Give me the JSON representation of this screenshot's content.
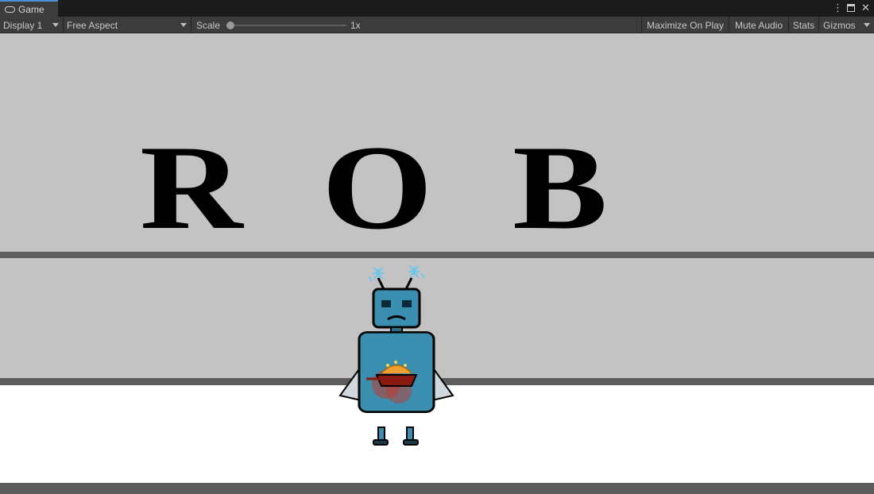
{
  "window": {
    "tab_label": "Game",
    "tab_icon": "gamepad-icon"
  },
  "toolbar": {
    "display": "Display 1",
    "aspect": "Free Aspect",
    "scale_label": "Scale",
    "scale_value": "1x",
    "scale_slider_fraction": 0.0,
    "maximize_on_play": "Maximize On Play",
    "mute_audio": "Mute Audio",
    "stats": "Stats",
    "gizmos": "Gizmos"
  },
  "scene": {
    "letters": [
      "R",
      "O",
      "B"
    ],
    "character": "robot",
    "colors": {
      "background": "#c3c3c3",
      "bands": "#5d5d5d",
      "floor": "#ffffff",
      "robot_body": "#3a8fb0",
      "robot_outline": "#000000",
      "sparks": "#6ec6e8",
      "chest_emblem": "#c0392b"
    }
  }
}
